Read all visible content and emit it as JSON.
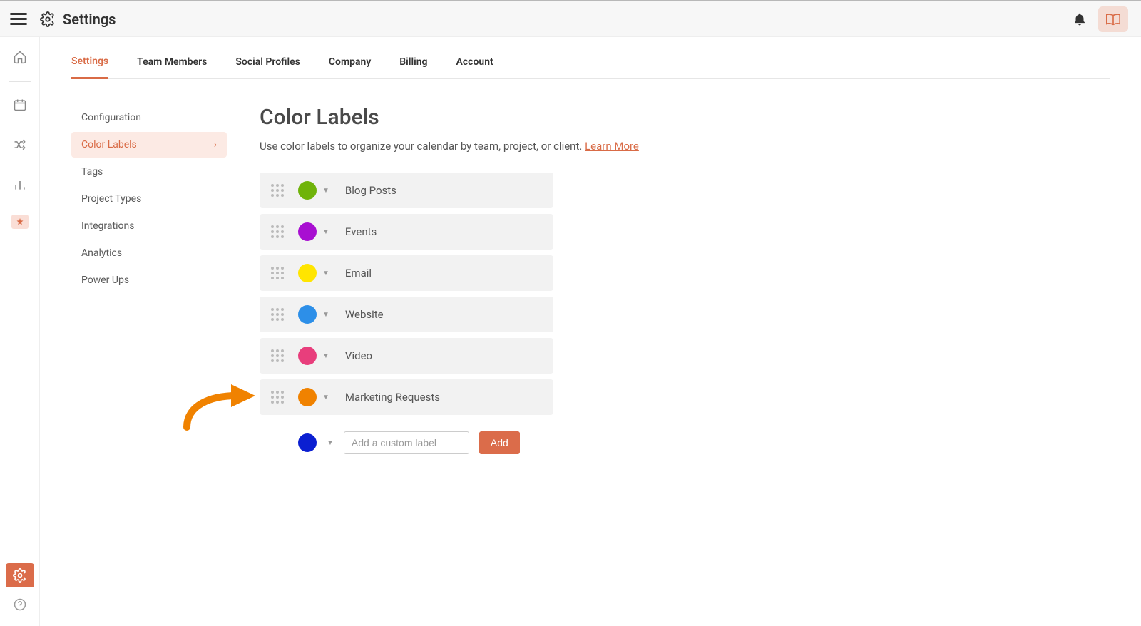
{
  "header": {
    "title": "Settings"
  },
  "tabs": [
    {
      "label": "Settings",
      "active": true
    },
    {
      "label": "Team Members"
    },
    {
      "label": "Social Profiles"
    },
    {
      "label": "Company"
    },
    {
      "label": "Billing"
    },
    {
      "label": "Account"
    }
  ],
  "sidenav": [
    {
      "label": "Configuration"
    },
    {
      "label": "Color Labels",
      "active": true
    },
    {
      "label": "Tags"
    },
    {
      "label": "Project Types"
    },
    {
      "label": "Integrations"
    },
    {
      "label": "Analytics"
    },
    {
      "label": "Power Ups"
    }
  ],
  "page": {
    "title": "Color Labels",
    "description": "Use color labels to organize your calendar by team, project, or client. ",
    "learn_more": "Learn More"
  },
  "labels": [
    {
      "name": "Blog Posts",
      "color": "#6fb30a"
    },
    {
      "name": "Events",
      "color": "#a80fd1"
    },
    {
      "name": "Email",
      "color": "#ffe500"
    },
    {
      "name": "Website",
      "color": "#2d8fe8"
    },
    {
      "name": "Video",
      "color": "#e83e7c"
    },
    {
      "name": "Marketing Requests",
      "color": "#f08200"
    }
  ],
  "add": {
    "swatch_color": "#0b1fd1",
    "placeholder": "Add a custom label",
    "button": "Add"
  },
  "accent": "#d96b46"
}
